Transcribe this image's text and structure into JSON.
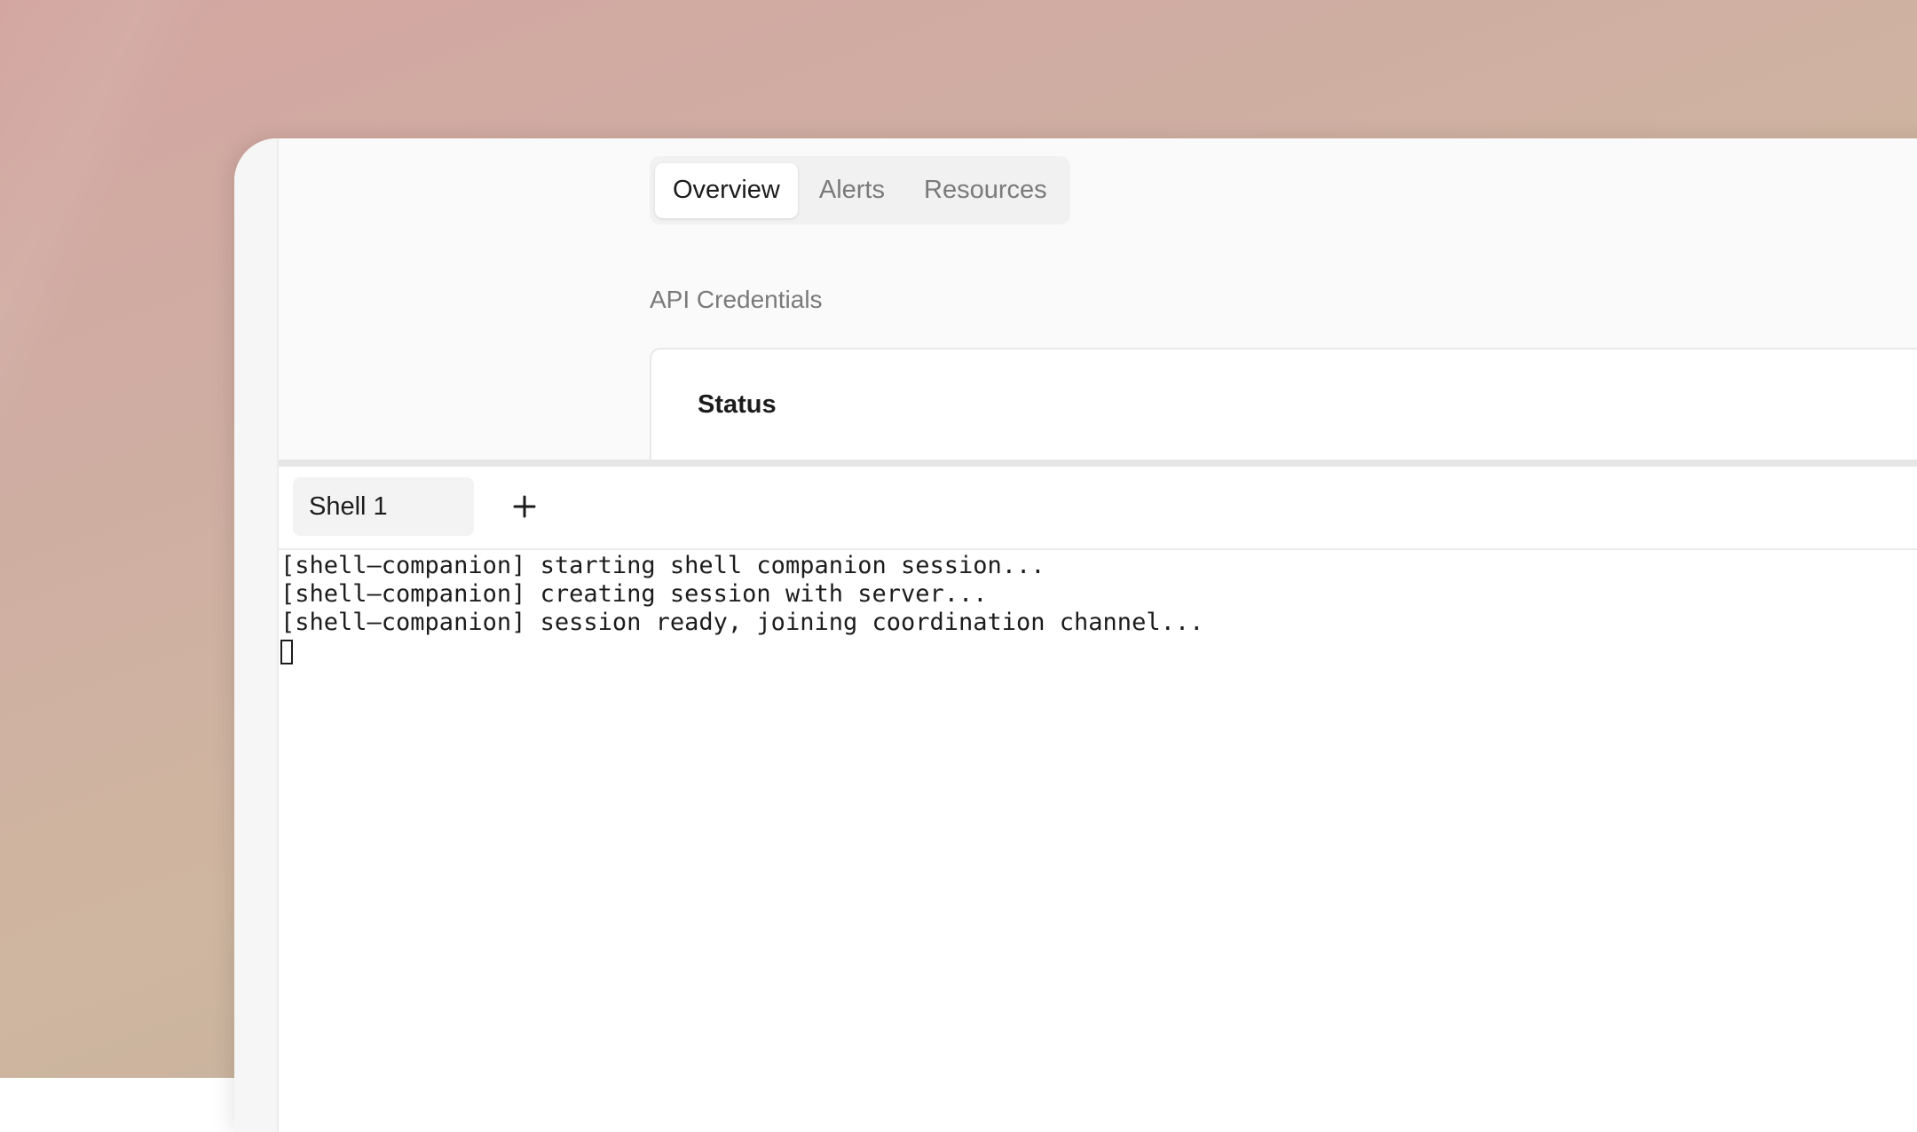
{
  "content": {
    "tabs": [
      {
        "label": "Overview",
        "active": true
      },
      {
        "label": "Alerts",
        "active": false
      },
      {
        "label": "Resources",
        "active": false
      }
    ],
    "section_title": "API Credentials",
    "card": {
      "title": "Status"
    }
  },
  "terminal": {
    "tabs": [
      {
        "label": "Shell 1"
      }
    ],
    "add_tab_icon": "plus-icon",
    "lines": [
      "[shell—companion] starting shell companion session...",
      "[shell—companion] creating session with server...",
      "[shell—companion] session ready, joining coordination channel..."
    ]
  },
  "colors": {
    "accent_text": "#1c1c1c",
    "muted_text": "#7a7a7a",
    "panel_bg": "#fafafa"
  }
}
